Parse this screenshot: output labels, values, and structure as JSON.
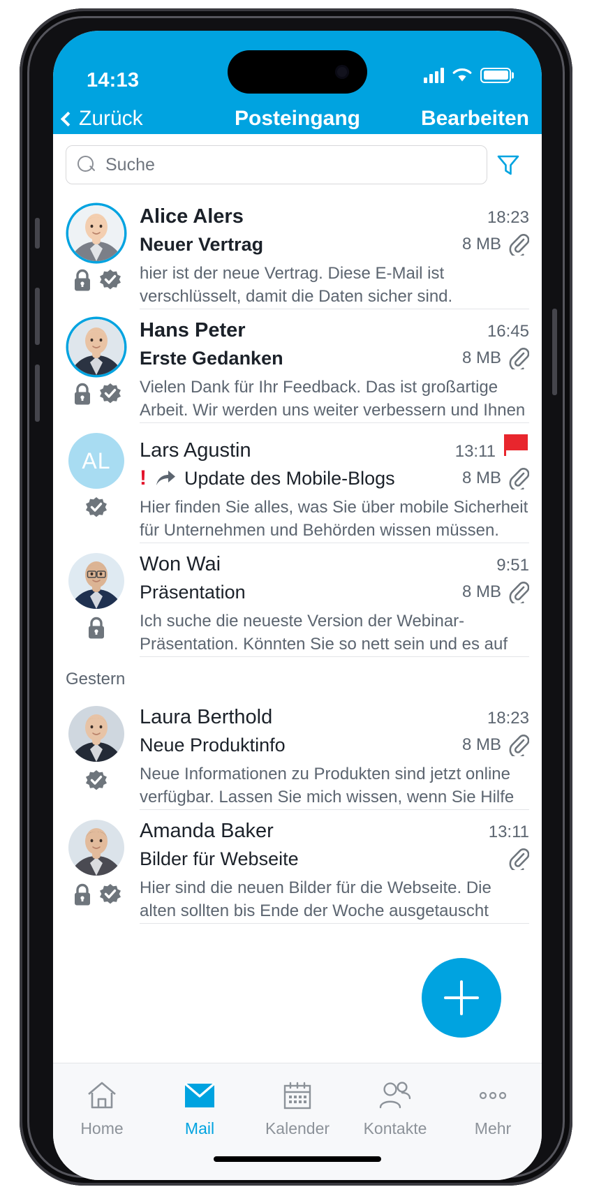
{
  "status_bar": {
    "time": "14:13",
    "signal_icon": "cellular-signal-icon",
    "wifi_icon": "wifi-icon",
    "battery_icon": "battery-full-icon"
  },
  "nav_bar": {
    "back_label": "Zurück",
    "title": "Posteingang",
    "edit_label": "Bearbeiten",
    "back_icon": "chevron-left-icon"
  },
  "search": {
    "placeholder": "Suche",
    "value": "",
    "icon": "search-icon",
    "filter_icon": "filter-funnel-icon"
  },
  "colors": {
    "accent": "#00a3e0",
    "flag_red": "#e8262d",
    "priority_red": "#e3132b",
    "badge_gray": "#6e757c",
    "text_primary": "#1b2129",
    "text_secondary": "#5c6570",
    "initials_bg": "#a8dcf2",
    "tabbar_bg": "#f7f8fa"
  },
  "sections": [
    {
      "header": null,
      "emails": [
        {
          "sender": "Alice Alers",
          "time": "18:23",
          "subject": "Neuer Vertrag",
          "size": "8 MB",
          "preview": "hier ist der neue Vertrag. Diese E-Mail ist verschlüsselt, damit die Daten sicher sind.",
          "unread": true,
          "avatar_type": "photo",
          "avatar_ring": true,
          "avatar_variant": "woman-blonde",
          "initials": "",
          "badges": [
            "lock-icon",
            "signed-seal-icon"
          ],
          "flagged": false,
          "priority": false,
          "forwarded": false,
          "attachment": true
        },
        {
          "sender": "Hans Peter",
          "time": "16:45",
          "subject": "Erste Gedanken",
          "size": "8 MB",
          "preview": "Vielen Dank für Ihr Feedback. Das ist großartige Arbeit. Wir werden uns weiter verbessern und Ihnen einen Status",
          "unread": true,
          "avatar_type": "photo",
          "avatar_ring": true,
          "avatar_variant": "man-older",
          "initials": "",
          "badges": [
            "lock-icon",
            "signed-seal-icon"
          ],
          "flagged": false,
          "priority": false,
          "forwarded": false,
          "attachment": true
        },
        {
          "sender": "Lars Agustin",
          "time": "13:11",
          "subject": "Update des Mobile-Blogs",
          "size": "8 MB",
          "preview": "Hier finden Sie alles, was Sie über mobile Sicherheit für Unternehmen und Behörden wissen müssen. Lesen Sie",
          "unread": false,
          "avatar_type": "initials",
          "avatar_ring": false,
          "avatar_variant": "",
          "initials": "AL",
          "badges": [
            "signed-seal-icon"
          ],
          "flagged": true,
          "priority": true,
          "forwarded": true,
          "attachment": true
        },
        {
          "sender": "Won Wai",
          "time": "9:51",
          "subject": "Präsentation",
          "size": "8 MB",
          "preview": "Ich suche die neueste Version der Webinar-Präsentation. Könnten Sie so nett sein und es auf das Fileshare legen,",
          "unread": false,
          "avatar_type": "photo",
          "avatar_ring": false,
          "avatar_variant": "man-glasses",
          "initials": "",
          "badges": [
            "lock-icon"
          ],
          "flagged": false,
          "priority": false,
          "forwarded": false,
          "attachment": true
        }
      ]
    },
    {
      "header": "Gestern",
      "emails": [
        {
          "sender": "Laura Berthold",
          "time": "18:23",
          "subject": "Neue Produktinfo",
          "size": "8 MB",
          "preview": "Neue Informationen zu Produkten sind jetzt online verfügbar. Lassen Sie mich wissen, wenn Sie Hilfe benötigen.",
          "unread": false,
          "avatar_type": "photo",
          "avatar_ring": false,
          "avatar_variant": "woman-dark-blazer",
          "initials": "",
          "badges": [
            "signed-seal-icon"
          ],
          "flagged": false,
          "priority": false,
          "forwarded": false,
          "attachment": true
        },
        {
          "sender": "Amanda Baker",
          "time": "13:11",
          "subject": "Bilder für Webseite",
          "size": "",
          "preview": "Hier sind die neuen Bilder für die Webseite. Die alten sollten bis Ende der Woche ausgetauscht werden.",
          "unread": false,
          "avatar_type": "photo",
          "avatar_ring": false,
          "avatar_variant": "woman-brunette",
          "initials": "",
          "badges": [
            "lock-icon",
            "signed-seal-icon"
          ],
          "flagged": false,
          "priority": false,
          "forwarded": false,
          "attachment": true
        }
      ]
    }
  ],
  "compose_button": {
    "icon": "plus-icon",
    "label": ""
  },
  "tab_bar": {
    "items": [
      {
        "label": "Home",
        "icon": "home-icon",
        "active": false
      },
      {
        "label": "Mail",
        "icon": "mail-icon",
        "active": true
      },
      {
        "label": "Kalender",
        "icon": "calendar-icon",
        "active": false
      },
      {
        "label": "Kontakte",
        "icon": "contacts-icon",
        "active": false
      },
      {
        "label": "Mehr",
        "icon": "more-dots-icon",
        "active": false
      }
    ]
  }
}
